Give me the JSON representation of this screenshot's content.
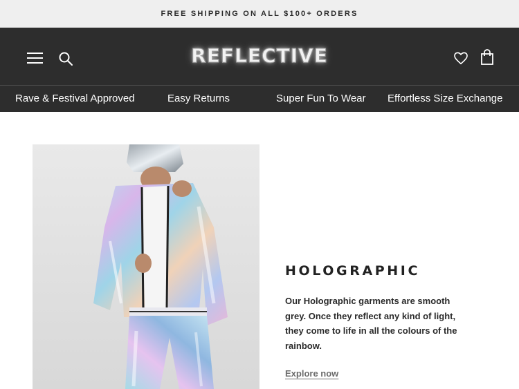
{
  "announcement": {
    "text": "FREE SHIPPING ON ALL $100+ ORDERS"
  },
  "header": {
    "logo_text": "REFLECTIVE",
    "menu_icon": "hamburger-menu-icon",
    "search_icon": "search-icon",
    "wishlist_icon": "heart-icon",
    "cart_icon": "shopping-bag-icon",
    "background": "#2d2d2d"
  },
  "usp_bar": {
    "items": [
      {
        "label": "Rave & Festival Approved"
      },
      {
        "label": "Easy Returns"
      },
      {
        "label": "Super Fun To Wear"
      },
      {
        "label": "Effortless Size Exchange"
      }
    ]
  },
  "feature": {
    "image_alt": "Model wearing holographic reflective jacket and pants",
    "title": "HOLOGRAPHIC",
    "description": "Our Holographic garments are smooth grey. Once they reflect any kind of light, they come to life in all the colours of the rainbow.",
    "cta_label": "Explore now"
  }
}
